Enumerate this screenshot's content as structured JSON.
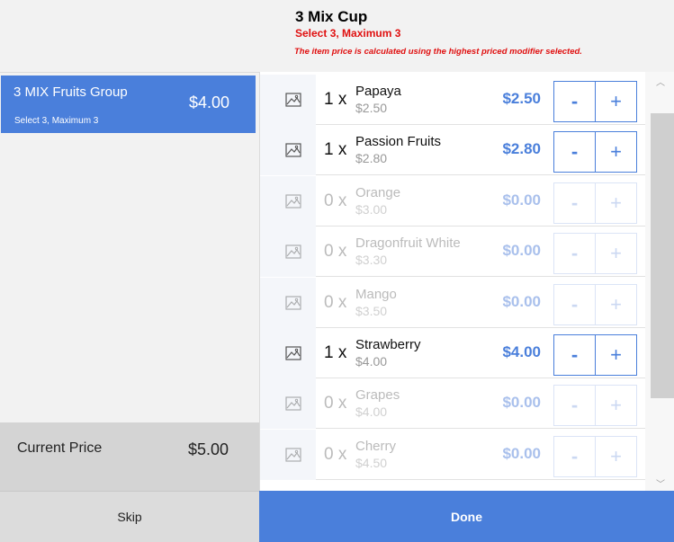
{
  "header": {
    "title": "3 Mix Cup",
    "subtitle": "Select 3, Maximum 3",
    "note": "The item price is calculated using the highest priced modifier selected."
  },
  "group": {
    "name": "3 MIX Fruits Group",
    "price": "$4.00",
    "rule": "Select 3, Maximum 3"
  },
  "current_price": {
    "label": "Current Price",
    "value": "$5.00"
  },
  "items": [
    {
      "qty": "1 x",
      "name": "Papaya",
      "base": "$2.50",
      "total": "$2.50",
      "minus": "-",
      "plus": "+"
    },
    {
      "qty": "1 x",
      "name": "Passion Fruits",
      "base": "$2.80",
      "total": "$2.80",
      "minus": "-",
      "plus": "+"
    },
    {
      "qty": "0 x",
      "name": "Orange",
      "base": "$3.00",
      "total": "$0.00",
      "minus": "-",
      "plus": "+"
    },
    {
      "qty": "0 x",
      "name": "Dragonfruit White",
      "base": "$3.30",
      "total": "$0.00",
      "minus": "-",
      "plus": "+"
    },
    {
      "qty": "0 x",
      "name": "Mango",
      "base": "$3.50",
      "total": "$0.00",
      "minus": "-",
      "plus": "+"
    },
    {
      "qty": "1 x",
      "name": "Strawberry",
      "base": "$4.00",
      "total": "$4.00",
      "minus": "-",
      "plus": "+"
    },
    {
      "qty": "0 x",
      "name": "Grapes",
      "base": "$4.00",
      "total": "$0.00",
      "minus": "-",
      "plus": "+"
    },
    {
      "qty": "0 x",
      "name": "Cherry",
      "base": "$4.50",
      "total": "$0.00",
      "minus": "-",
      "plus": "+"
    }
  ],
  "footer": {
    "skip": "Skip",
    "done": "Done"
  },
  "colors": {
    "accent": "#4a7fdb",
    "warning": "#e01010"
  },
  "icons": {
    "item_thumbnail": "image-placeholder-icon",
    "scroll_up": "chevron-up-icon",
    "scroll_down": "chevron-down-icon"
  }
}
